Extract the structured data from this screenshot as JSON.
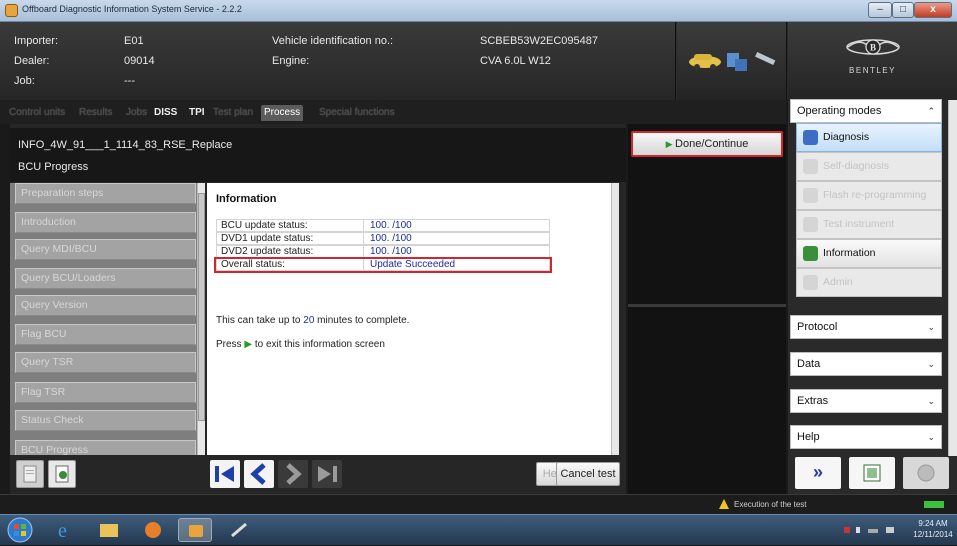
{
  "window": {
    "title": "Offboard Diagnostic Information System Service - 2.2.2",
    "controls": {
      "minimize": "–",
      "maximize": "□",
      "close": "x"
    }
  },
  "header": {
    "importer_label": "Importer:",
    "importer_value": "E01",
    "dealer_label": "Dealer:",
    "dealer_value": "09014",
    "job_label": "Job:",
    "job_value": "---",
    "vin_label": "Vehicle identification no.:",
    "vin_value": "SCBEB53W2EC095487",
    "engine_label": "Engine:",
    "engine_value": "CVA 6.0L W12",
    "brand": "BENTLEY",
    "brand_logo": "B"
  },
  "tabs": [
    {
      "label": "Control units"
    },
    {
      "label": "Results"
    },
    {
      "label": "Jobs"
    },
    {
      "label": "DISS"
    },
    {
      "label": "TPI"
    },
    {
      "label": "Test plan"
    },
    {
      "label": "Process"
    },
    {
      "label": "Special functions"
    }
  ],
  "process": {
    "title": "INFO_4W_91___1_1114_83_RSE_Replace",
    "subtitle": "BCU Progress"
  },
  "steps": [
    {
      "label": "Preparation steps"
    },
    {
      "label": "Introduction"
    },
    {
      "label": "Query MDI/BCU"
    },
    {
      "label": "Query BCU/Loaders"
    },
    {
      "label": "Query Version"
    },
    {
      "label": "Flag BCU"
    },
    {
      "label": "Query TSR"
    },
    {
      "label": "Flag TSR"
    },
    {
      "label": "Status Check"
    },
    {
      "label": "BCU Progress"
    }
  ],
  "info": {
    "heading": "Information",
    "rows": [
      {
        "label": "BCU update status:",
        "value": "100. /100"
      },
      {
        "label": "DVD1 update status:",
        "value": "100. /100"
      },
      {
        "label": "DVD2 update status:",
        "value": "100. /100"
      },
      {
        "label": "Overall status:",
        "value": "Update Succeeded"
      }
    ],
    "note_prefix": "This can take up to ",
    "note_minutes": "20",
    "note_suffix": " minutes to complete.",
    "press_prefix": "Press ",
    "press_suffix": " to exit this information screen",
    "highlight_color": "#d2262f",
    "value_color": "#1a2ca0"
  },
  "buttons": {
    "done": "Done/Continue",
    "help": "Help",
    "cancel": "Cancel test",
    "forward_icon": "double-chevron-right"
  },
  "operating_modes": {
    "title": "Operating modes",
    "items": [
      {
        "label": "Diagnosis"
      },
      {
        "label": "Self-diagnosis"
      },
      {
        "label": "Flash re-programming"
      },
      {
        "label": "Test instrument"
      },
      {
        "label": "Information"
      },
      {
        "label": "Admin"
      }
    ]
  },
  "sections": [
    {
      "label": "Protocol"
    },
    {
      "label": "Data"
    },
    {
      "label": "Extras"
    },
    {
      "label": "Help"
    }
  ],
  "status": {
    "message": "Execution of the test"
  },
  "taskbar": {
    "time": "9:24 AM",
    "date": "12/11/2014"
  }
}
